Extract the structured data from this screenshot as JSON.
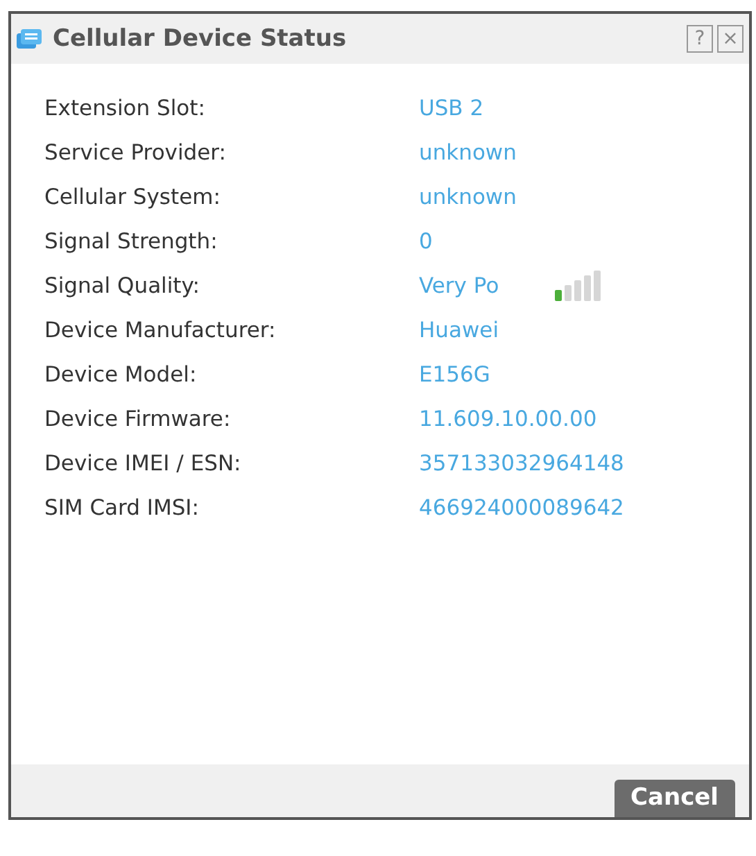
{
  "window": {
    "title": "Cellular Device Status"
  },
  "title_buttons": [
    "?",
    "×"
  ],
  "fields": [
    {
      "kind": "text",
      "label": "Extension Slot:",
      "value": "USB 2"
    },
    {
      "kind": "text",
      "label": "Service Provider:",
      "value": "unknown"
    },
    {
      "kind": "text",
      "label": "Cellular System:",
      "value": "unknown"
    },
    {
      "kind": "text",
      "label": "Signal Strength:",
      "value": "0"
    },
    {
      "kind": "signal",
      "label": "Signal Quality:",
      "value": "Very Po"
    },
    {
      "kind": "text",
      "label": "Device Manufacturer:",
      "value": "Huawei"
    },
    {
      "kind": "text",
      "label": "Device Model:",
      "value": "E156G"
    },
    {
      "kind": "text",
      "label": "Device Firmware:",
      "value": "11.609.10.00.00"
    },
    {
      "kind": "text",
      "label": "Device IMEI / ESN:",
      "value": "357133032964148"
    },
    {
      "kind": "text",
      "label": "SIM Card IMSI:",
      "value": "466924000089642"
    }
  ],
  "buttons": [
    "Cancel"
  ]
}
